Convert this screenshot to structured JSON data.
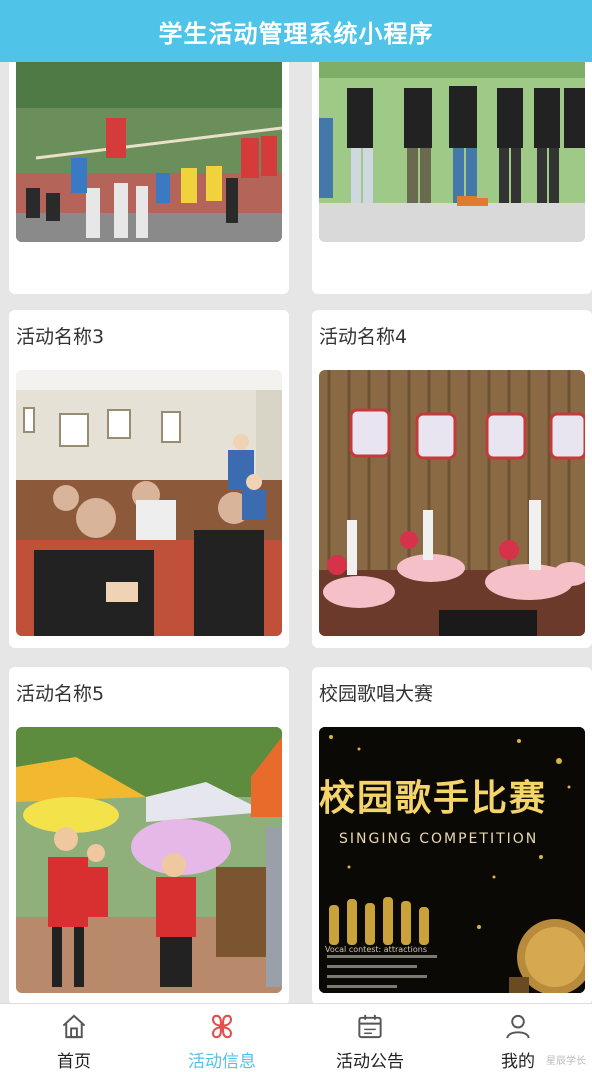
{
  "header": {
    "title": "学生活动管理系统小程序"
  },
  "activities": [
    {
      "title": "",
      "photo_icon": "tug-of-war-photo"
    },
    {
      "title": "",
      "photo_icon": "roller-skating-photo"
    },
    {
      "title": "活动名称3",
      "photo_icon": "elderly-audience-photo"
    },
    {
      "title": "活动名称4",
      "photo_icon": "stage-dance-photo"
    },
    {
      "title": "活动名称5",
      "photo_icon": "volunteer-booth-photo"
    },
    {
      "title": "校园歌唱大赛",
      "photo_icon": "singing-poster-photo"
    }
  ],
  "poster": {
    "headline": "校园歌手比赛",
    "subline": "SINGING COMPETITION",
    "note": "Vocal contest: attractions"
  },
  "tabs": [
    {
      "label": "首页",
      "icon": "home-icon",
      "active": false
    },
    {
      "label": "活动信息",
      "icon": "clover-icon",
      "active": true
    },
    {
      "label": "活动公告",
      "icon": "calendar-icon",
      "active": false
    },
    {
      "label": "我的",
      "icon": "user-icon",
      "active": false
    }
  ],
  "watermark": "星辰学长",
  "colors": {
    "accent": "#4fc3e8",
    "clover": "#e0504d"
  }
}
